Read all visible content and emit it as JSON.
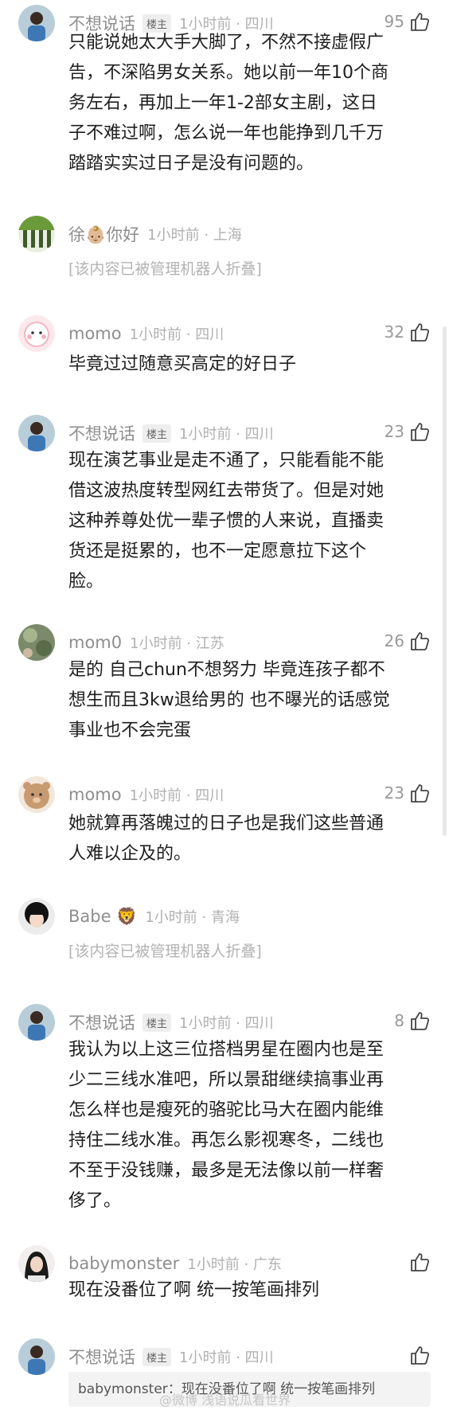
{
  "comments": [
    {
      "name": "不想说话",
      "owner_badge": "楼主",
      "meta": "1小时前 · 四川",
      "likes": "95",
      "lines": [
        "只能说她太大手大脚了，不然不接虚假广",
        "告，不深陷男女关系。她以前一年10个商",
        "务左右，再加上一年1-2部女主剧，这日",
        "子不难过啊，怎么说一年也能挣到几千万",
        "踏踏实实过日子是没有问题的。"
      ]
    },
    {
      "name": "徐👶🏼你好",
      "meta": "1小时前 · 上海",
      "folded": "[该内容已被管理机器人折叠]"
    },
    {
      "name": "momo",
      "meta": "1小时前 · 四川",
      "likes": "32",
      "lines": [
        "毕竟过过随意买高定的好日子"
      ]
    },
    {
      "name": "不想说话",
      "owner_badge": "楼主",
      "meta": "1小时前 · 四川",
      "likes": "23",
      "lines": [
        "现在演艺事业是走不通了，只能看能不能",
        "借这波热度转型网红去带货了。但是对她",
        "这种养尊处优一辈子惯的人来说，直播卖",
        "货还是挺累的，也不一定愿意拉下这个",
        "脸。"
      ]
    },
    {
      "name": "mom0",
      "meta": "1小时前 · 江苏",
      "likes": "26",
      "lines": [
        "是的 自己chun不想努力 毕竟连孩子都不",
        "想生而且3kw退给男的 也不曝光的话感觉",
        "事业也不会完蛋"
      ]
    },
    {
      "name": "momo",
      "meta": "1小时前 · 四川",
      "likes": "23",
      "lines": [
        "她就算再落魄过的日子也是我们这些普通",
        "人难以企及的。"
      ]
    },
    {
      "name": "Babe 🦁",
      "meta": "1小时前 · 青海",
      "folded": "[该内容已被管理机器人折叠]"
    },
    {
      "name": "不想说话",
      "owner_badge": "楼主",
      "meta": "1小时前 · 四川",
      "likes": "8",
      "lines": [
        "我认为以上这三位搭档男星在圈内也是至",
        "少二三线水准吧，所以景甜继续搞事业再",
        "怎么样也是瘦死的骆驼比马大在圈内能维",
        "持住二线水准。再怎么影视寒冬，二线也",
        "不至于没钱赚，最多是无法像以前一样奢",
        "侈了。"
      ]
    },
    {
      "name": "babymonster",
      "meta": "1小时前 · 广东",
      "lines": [
        "现在没番位了啊 统一按笔画排列"
      ]
    },
    {
      "name": "不想说话",
      "owner_badge": "楼主",
      "meta": "1小时前 · 四川",
      "quote": "babymonster：现在没番位了啊 统一按笔画排列"
    }
  ],
  "watermark": "@微博 浅语说瓜看世界",
  "colors": {
    "text": "#1e1e1e",
    "name": "#8e8e8e",
    "meta": "#b0b0b0",
    "folded": "#b3b3b3"
  }
}
